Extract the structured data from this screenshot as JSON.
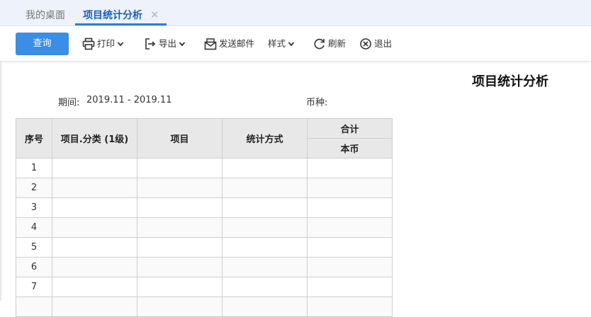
{
  "tabs": {
    "home": "我的桌面",
    "active": "项目统计分析",
    "close_glyph": "✕"
  },
  "toolbar": {
    "query": "查询",
    "print": "打印",
    "export": "导出",
    "send_mail": "发送邮件",
    "style": "样式",
    "refresh": "刷新",
    "exit": "退出"
  },
  "report": {
    "title": "项目统计分析",
    "period_label": "期间:",
    "period_value": "2019.11 - 2019.11",
    "currency_label": "币种:",
    "currency_value": ""
  },
  "table": {
    "headers": {
      "seq": "序号",
      "category": "项目.分类 (1级)",
      "item": "项目",
      "method": "统计方式",
      "total": "合计",
      "local_currency": "本币"
    },
    "rows": [
      {
        "seq": "1",
        "category": "",
        "item": "",
        "method": "",
        "amount": ""
      },
      {
        "seq": "2",
        "category": "",
        "item": "",
        "method": "",
        "amount": ""
      },
      {
        "seq": "3",
        "category": "",
        "item": "",
        "method": "",
        "amount": ""
      },
      {
        "seq": "4",
        "category": "",
        "item": "",
        "method": "",
        "amount": ""
      },
      {
        "seq": "5",
        "category": "",
        "item": "",
        "method": "",
        "amount": ""
      },
      {
        "seq": "6",
        "category": "",
        "item": "",
        "method": "",
        "amount": ""
      },
      {
        "seq": "7",
        "category": "",
        "item": "",
        "method": "",
        "amount": ""
      },
      {
        "seq": "",
        "category": "",
        "item": "",
        "method": "",
        "amount": ""
      }
    ]
  },
  "icons": {
    "print": "printer-icon",
    "export": "export-icon",
    "send_mail": "envelope-icon",
    "refresh": "refresh-icon",
    "exit": "close-circle-icon",
    "dropdown": "chevron-down-icon"
  },
  "colors": {
    "primary": "#3a8ee6",
    "tab_active": "#1e5fb8",
    "tabbar_bg": "#eef3fb",
    "header_bg": "#e8e8e8"
  }
}
